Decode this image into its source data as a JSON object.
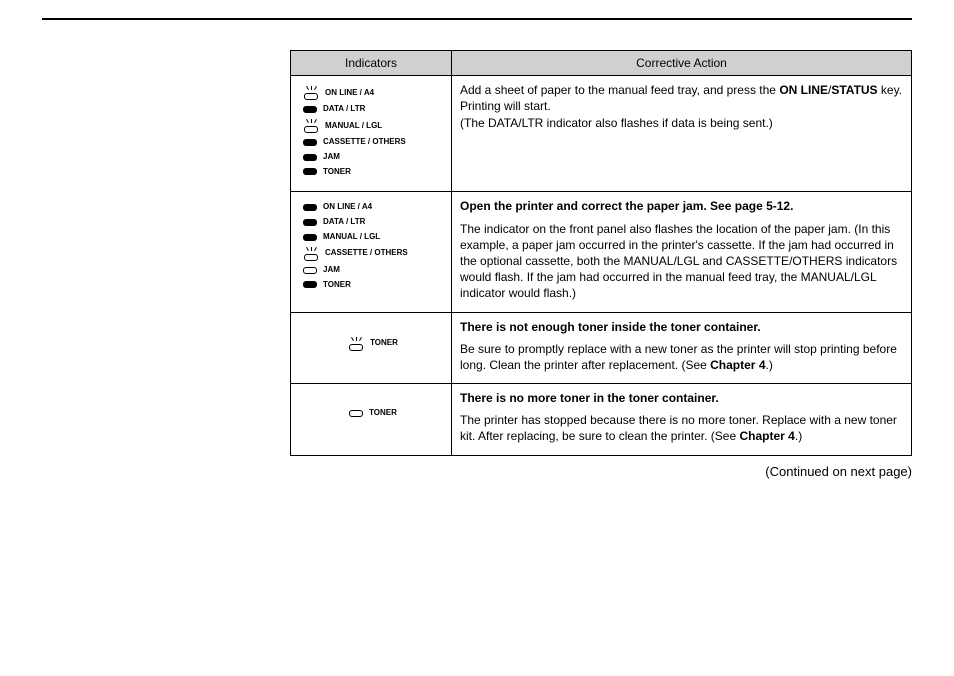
{
  "table": {
    "headers": {
      "indicators": "Indicators",
      "action": "Corrective Action"
    },
    "row1": {
      "ind": {
        "online": "ON LINE / A4",
        "data": "DATA / LTR",
        "manual": "MANUAL / LGL",
        "cassette": "CASSETTE / OTHERS",
        "jam": "JAM",
        "toner": "TONER"
      },
      "action": {
        "pre": "Add a sheet of paper to the manual feed tray, and press the ",
        "bold1": "ON LINE",
        "slash": "/",
        "bold2": "STATUS",
        "post": " key. Printing will start.",
        "note": "(The DATA/LTR indicator also flashes if data is being sent.)"
      }
    },
    "row2": {
      "ind": {
        "online": "ON LINE / A4",
        "data": "DATA / LTR",
        "manual": "MANUAL / LGL",
        "cassette": "CASSETTE / OTHERS",
        "jam": "JAM",
        "toner": "TONER"
      },
      "action": {
        "title": "Open the printer and correct the paper jam. See page 5-12.",
        "body": "The indicator on the front panel also flashes the location of the paper jam. (In this example, a paper jam occurred in the printer's cassette.  If the jam had occurred in the optional cassette, both the MANUAL/LGL and CASSETTE/OTHERS indicators would flash. If the jam had occurred in the manual feed tray, the MANUAL/LGL indicator would flash.)"
      }
    },
    "row3": {
      "ind": {
        "toner": "TONER"
      },
      "action": {
        "title": "There is not enough toner inside the toner container.",
        "body_pre": "Be sure to promptly replace with a new toner as the printer will stop printing before long. Clean the printer after replacement.  (See ",
        "bold": "Chapter 4",
        "body_post": ".)"
      }
    },
    "row4": {
      "ind": {
        "toner": "TONER"
      },
      "action": {
        "title": "There is no more toner in the toner container.",
        "body_pre": "The printer has stopped because there is no more toner. Replace with a new toner kit. After replacing, be sure to clean the printer. (See ",
        "bold": "Chapter 4",
        "body_post": ".)"
      }
    }
  },
  "continued": "(Continued on next page)"
}
